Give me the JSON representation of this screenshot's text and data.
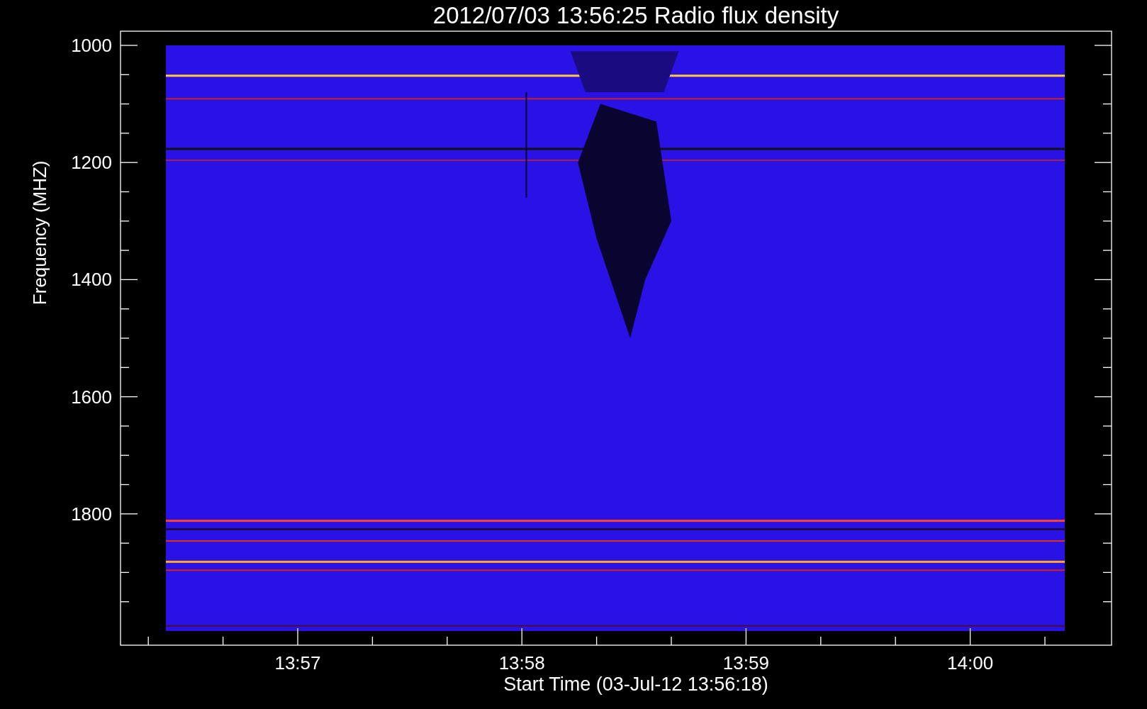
{
  "title": "2012/07/03 13:56:25 Radio flux density",
  "plot": {
    "ylabel": "Frequency (MHZ)",
    "ytick_labels": [
      "1000",
      "1200",
      "1400",
      "1600",
      "1800"
    ],
    "xtick_labels": [
      "13:57",
      "13:58",
      "13:59",
      "14:00"
    ],
    "xlabel": "Start Time (03-Jul-12 13:56:18)"
  }
}
